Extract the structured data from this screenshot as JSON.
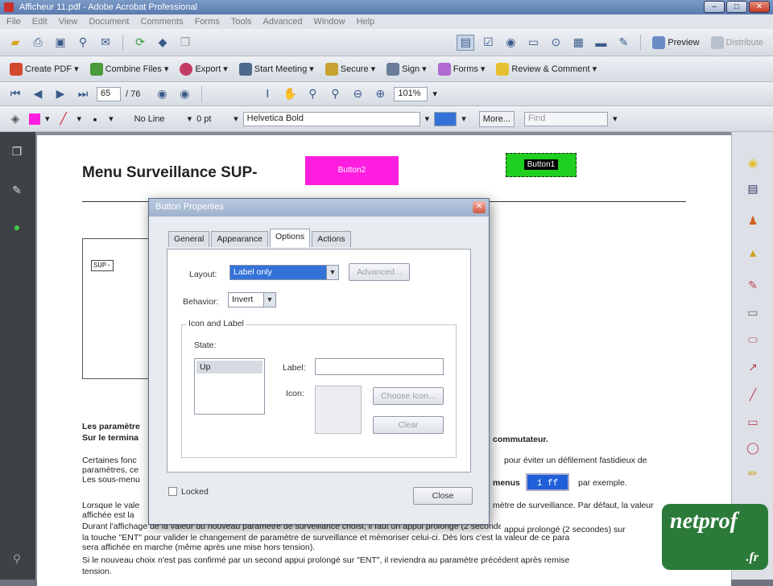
{
  "window": {
    "title": "Afficheur 11.pdf - Adobe Acrobat Professional",
    "btn_min": "–",
    "btn_max": "□",
    "btn_close": "✕"
  },
  "menu": [
    "File",
    "Edit",
    "View",
    "Document",
    "Comments",
    "Forms",
    "Tools",
    "Advanced",
    "Window",
    "Help"
  ],
  "toolbar1": {
    "preview_label": "Preview",
    "distribute_label": "Distribute"
  },
  "toolbar2": {
    "create_pdf": "Create PDF",
    "combine": "Combine Files",
    "export": "Export",
    "meeting": "Start Meeting",
    "secure": "Secure",
    "sign": "Sign",
    "forms": "Forms",
    "review": "Review & Comment"
  },
  "toolbar3": {
    "page_current": "65",
    "page_total": "/ 76",
    "zoom": "101%"
  },
  "toolbar4": {
    "line_style": "No Line",
    "line_width": "0 pt",
    "font": "Helvetica Bold",
    "font_size": "",
    "more_label": "More...",
    "find_placeholder": "Find",
    "fill_color": "#ff1de0"
  },
  "page": {
    "title": "Menu Surveillance SUP-",
    "pink_button": "Button2",
    "green_button": "Button1",
    "diagram_label": "SUP-",
    "lcd_value": "1 ff",
    "para1_a": "Les paramètre",
    "para1_b": "Sur le termina",
    "para1_right": "commutateur.",
    "para2_a": "Certaines fonc",
    "para2_b": "paramètres, ce",
    "para2_c": "Les sous-menu",
    "para2_right": "pour éviter un défilement fastidieux de",
    "para2_right2": "appui prolongé (2 secondes) sur",
    "menus_label": "menus",
    "par_exemple": "par exemple.",
    "para3_a": "Lorsque le vale",
    "para3_b": "affichée est la",
    "para3_right": "mètre de surveillance. Par défaut, la valeur",
    "para4": "Durant l'affichage de la valeur du nouveau paramètre de surveillance choisi, il faut un appui prolongé (2 secondes) sur",
    "para5": "la touche \"ENT\" pour valider le changement de paramètre de surveillance et mémoriser celui-ci. Dès lors c'est la valeur de ce para",
    "para6": "sera affichée en marche (même après une mise hors tension).",
    "para7": "Si le nouveau choix n'est pas confirmé par un second appui prolongé sur \"ENT\", il reviendra au paramètre précédent après remise",
    "para8": "tension."
  },
  "dialog": {
    "title": "Button Properties",
    "tabs": [
      "General",
      "Appearance",
      "Options",
      "Actions"
    ],
    "active_tab": "Options",
    "layout_label": "Layout:",
    "layout_value": "Label only",
    "advanced_label": "Advanced...",
    "behavior_label": "Behavior:",
    "behavior_value": "Invert",
    "group_label": "Icon and Label",
    "state_label": "State:",
    "state_item": "Up",
    "label_label": "Label:",
    "label_value": "",
    "icon_label": "Icon:",
    "choose_icon": "Choose Icon...",
    "clear": "Clear",
    "locked_label": "Locked",
    "close_label": "Close"
  },
  "logo": {
    "main": "netprof",
    "sub": ".fr"
  }
}
